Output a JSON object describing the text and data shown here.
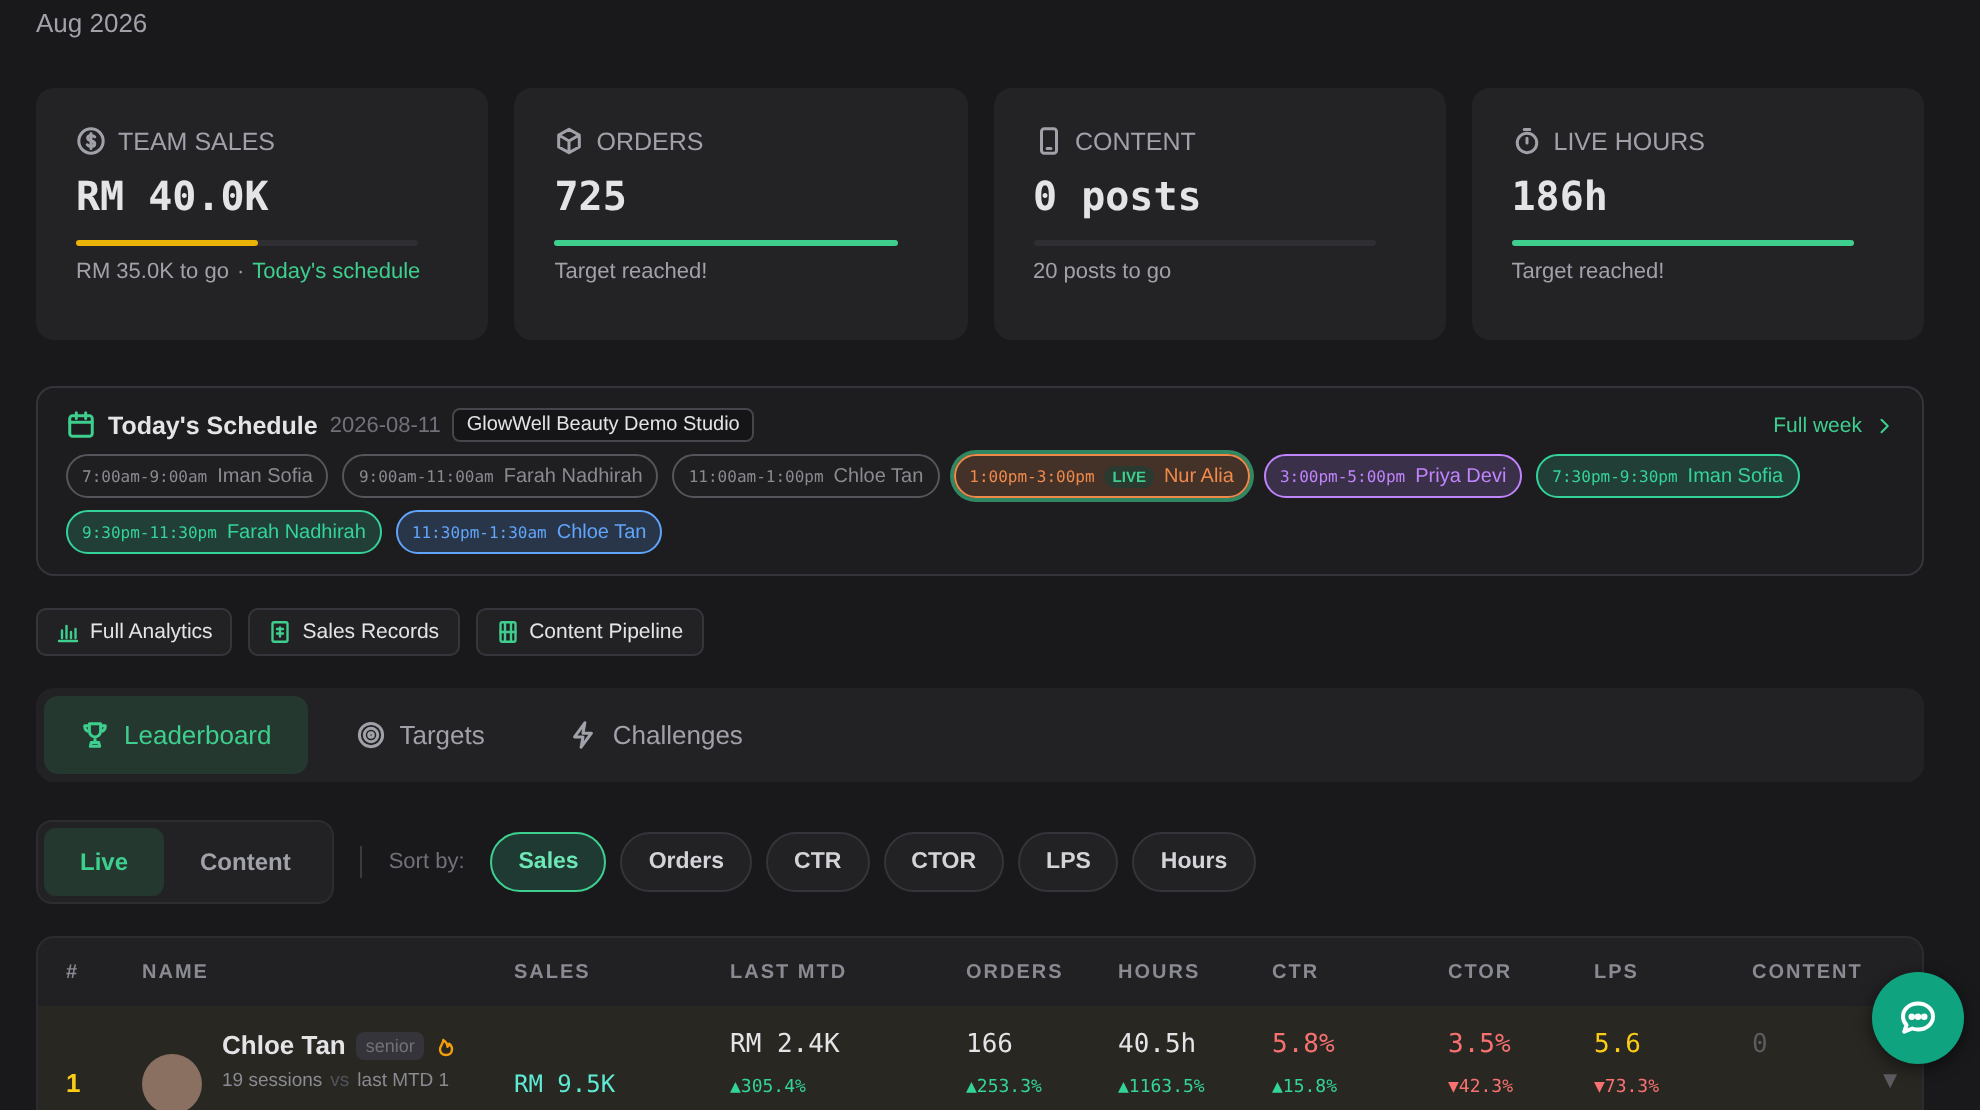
{
  "period": "Aug 2026",
  "stats": [
    {
      "label": "TEAM SALES",
      "value": "RM 40.0K",
      "level": 0.53,
      "note": "RM 35.0K to go",
      "sep": "·",
      "link": "Today's schedule"
    },
    {
      "label": "ORDERS",
      "value": "725",
      "level": 1,
      "note": "Target reached!"
    },
    {
      "label": "CONTENT",
      "value": "0 posts",
      "level": 0,
      "note": "20 posts to go"
    },
    {
      "label": "LIVE HOURS",
      "value": "186h",
      "level": 1,
      "note": "Target reached!"
    }
  ],
  "schedule": {
    "title": "Today's Schedule",
    "date": "2026-08-11",
    "studio": "GlowWell Beauty Demo Studio",
    "link": "Full week",
    "slots": [
      {
        "time": "7:00am-9:00am",
        "host": "Iman Sofia",
        "past": true,
        "live": false,
        "color": "#55555b"
      },
      {
        "time": "9:00am-11:00am",
        "host": "Farah Nadhirah",
        "past": true,
        "live": false,
        "color": "#55555b"
      },
      {
        "time": "11:00am-1:00pm",
        "host": "Chloe Tan",
        "past": true,
        "live": false,
        "color": "#55555b"
      },
      {
        "time": "1:00pm-3:00pm",
        "host": "Nur Alia",
        "past": false,
        "live": true,
        "badge": "LIVE",
        "color": "#f08a4b"
      },
      {
        "time": "3:00pm-5:00pm",
        "host": "Priya Devi",
        "past": false,
        "live": false,
        "color": "#c084fc"
      },
      {
        "time": "7:30pm-9:30pm",
        "host": "Iman Sofia",
        "past": false,
        "live": false,
        "color": "#34d399"
      },
      {
        "time": "9:30pm-11:30pm",
        "host": "Farah Nadhirah",
        "past": false,
        "live": false,
        "color": "#34d399"
      },
      {
        "time": "11:30pm-1:30am",
        "host": "Chloe Tan",
        "past": false,
        "live": false,
        "color": "#60a5fa"
      }
    ]
  },
  "quick_links": [
    {
      "label": "Full Analytics"
    },
    {
      "label": "Sales Records"
    },
    {
      "label": "Content Pipeline"
    }
  ],
  "tabs": [
    {
      "label": "Leaderboard",
      "selected": true
    },
    {
      "label": "Targets",
      "selected": false
    },
    {
      "label": "Challenges",
      "selected": false
    }
  ],
  "modes": [
    {
      "label": "Live",
      "selected": true
    },
    {
      "label": "Content",
      "selected": false
    }
  ],
  "sort": {
    "label": "Sort by:",
    "options": [
      {
        "label": "Sales",
        "selected": true
      },
      {
        "label": "Orders",
        "selected": false
      },
      {
        "label": "CTR",
        "selected": false
      },
      {
        "label": "CTOR",
        "selected": false
      },
      {
        "label": "LPS",
        "selected": false
      },
      {
        "label": "Hours",
        "selected": false
      }
    ]
  },
  "table": {
    "columns": [
      "#",
      "NAME",
      "SALES",
      "LAST MTD",
      "ORDERS",
      "HOURS",
      "CTR",
      "CTOR",
      "LPS",
      "CONTENT"
    ],
    "rows": [
      {
        "cells": [
          {
            "kind": "rank",
            "value": "1"
          },
          {
            "kind": "person",
            "name": "Chloe Tan",
            "tag": "senior",
            "hot": true,
            "sub": "19 sessions",
            "vs": "vs",
            "sub2": "last MTD 1"
          },
          {
            "kind": "metric",
            "value": "RM 9.5K",
            "color": "#5eead4"
          },
          {
            "kind": "metric",
            "value": "RM 2.4K",
            "color": "#e4e4e7",
            "delta": "▲305.4%",
            "down": false
          },
          {
            "kind": "metric",
            "value": "166",
            "color": "#e4e4e7",
            "delta": "▲253.3%",
            "down": false
          },
          {
            "kind": "metric",
            "value": "40.5h",
            "color": "#e4e4e7",
            "delta": "▲1163.5%",
            "down": false
          },
          {
            "kind": "metric",
            "value": "5.8%",
            "color": "#f87171",
            "delta": "▲15.8%",
            "down": false
          },
          {
            "kind": "metric",
            "value": "3.5%",
            "color": "#f87171",
            "delta": "▼42.3%",
            "down": true
          },
          {
            "kind": "metric",
            "value": "5.6",
            "color": "#facc15",
            "delta": "▼73.3%",
            "down": true
          },
          {
            "kind": "metric",
            "value": "0",
            "color": "#5b5b60"
          }
        ],
        "caret": "▼"
      }
    ]
  }
}
